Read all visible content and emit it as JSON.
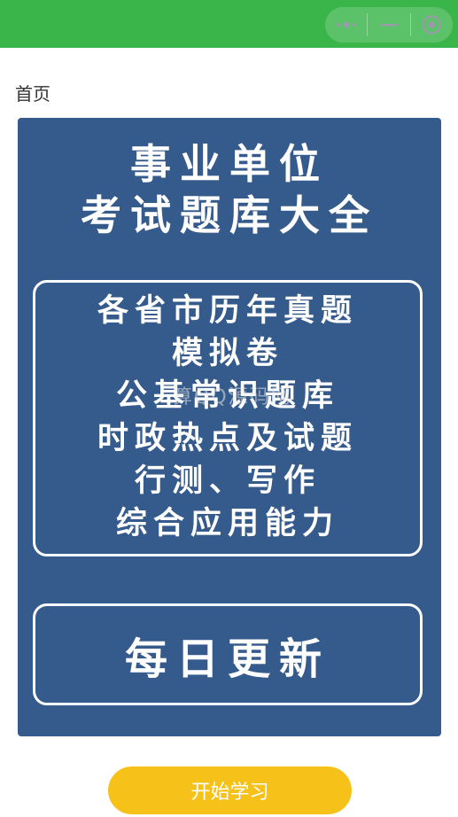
{
  "header": {
    "background": "#39b54a",
    "menu_icon": "more-dots-icon",
    "minimize_icon": "minimize-icon",
    "close_icon": "target-circle-icon"
  },
  "page": {
    "label": "首页"
  },
  "poster": {
    "background": "#355a8c",
    "title_line1": "事业单位",
    "title_line2": "考试题库大全",
    "features": [
      "各省市历年真题",
      "模拟卷",
      "公基常识题库",
      "时政热点及试题",
      "行测、写作",
      "综合应用能力"
    ],
    "daily_update": "每日更新",
    "watermark": "算QQ源码网"
  },
  "actions": {
    "start_label": "开始学习",
    "start_color": "#f6c21a"
  }
}
